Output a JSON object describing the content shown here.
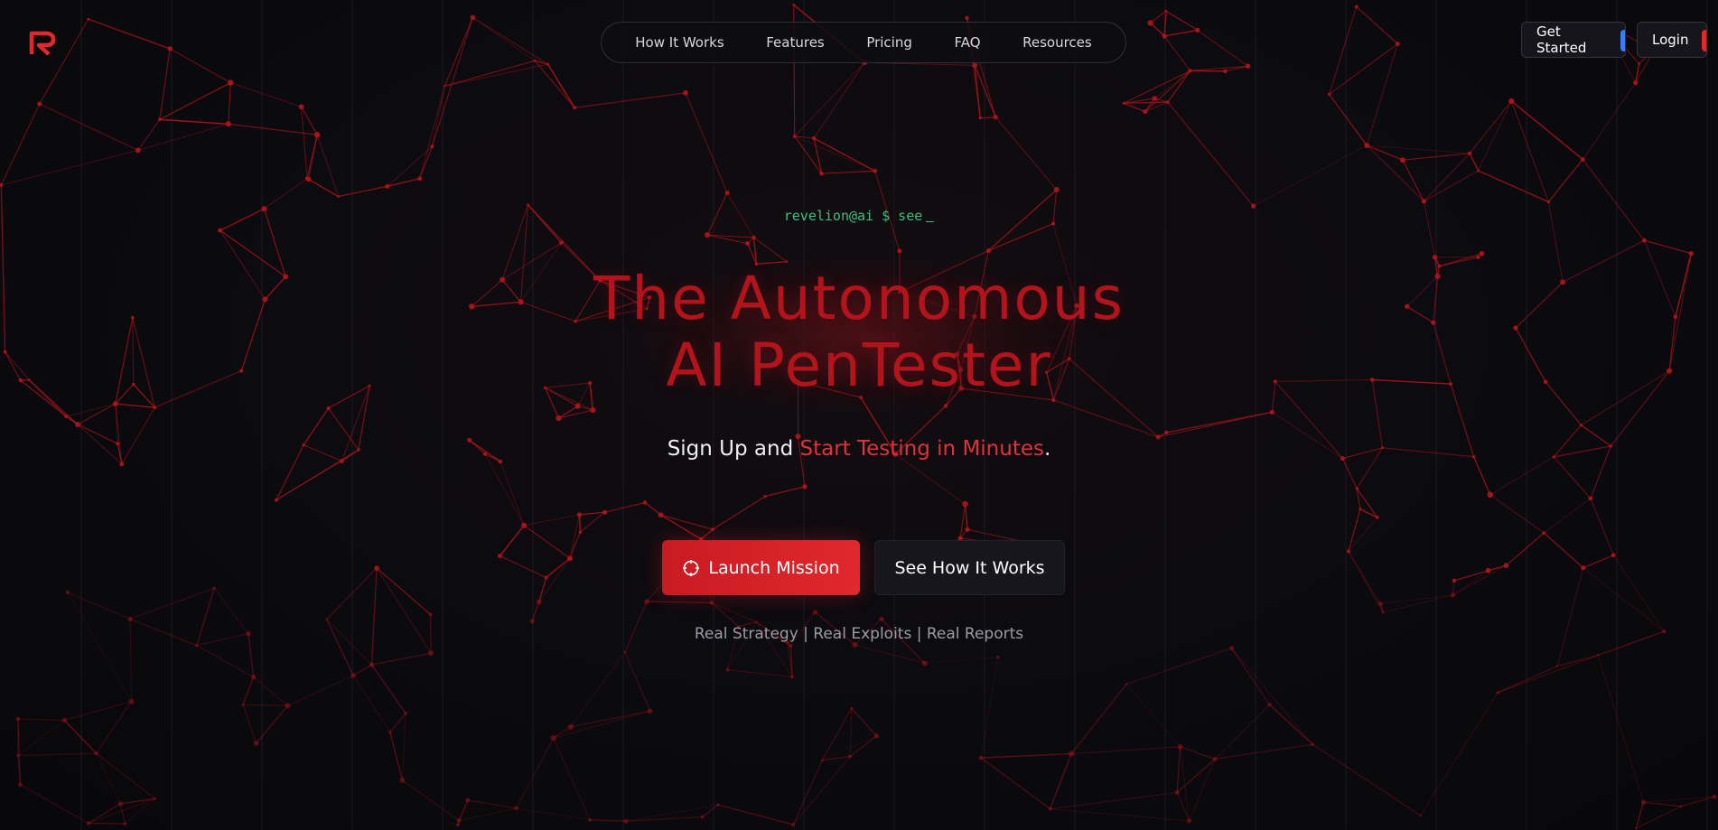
{
  "brand": {
    "logo_icon": "revelion-r-logo-icon",
    "accent": "#e0282d"
  },
  "nav": {
    "items": [
      {
        "label": "How It Works"
      },
      {
        "label": "Features"
      },
      {
        "label": "Pricing"
      },
      {
        "label": "FAQ"
      },
      {
        "label": "Resources"
      }
    ]
  },
  "header_actions": {
    "get_started": "Get Started",
    "login": "Login"
  },
  "hero": {
    "terminal_prompt": "revelion@ai $ see",
    "headline_line1": "The Autonomous",
    "headline_line2": "AI PenTester",
    "subhead_prefix": "Sign Up and ",
    "subhead_accent": "Start Testing in Minutes",
    "subhead_suffix": ".",
    "primary_cta": "Launch Mission",
    "secondary_cta": "See How It Works",
    "tagline": "Real Strategy | Real Exploits | Real Reports"
  },
  "colors": {
    "background": "#0b0b0f",
    "network_line": "#b3141c",
    "terminal_text": "#3fbf7f",
    "headline": "#b3141c"
  }
}
